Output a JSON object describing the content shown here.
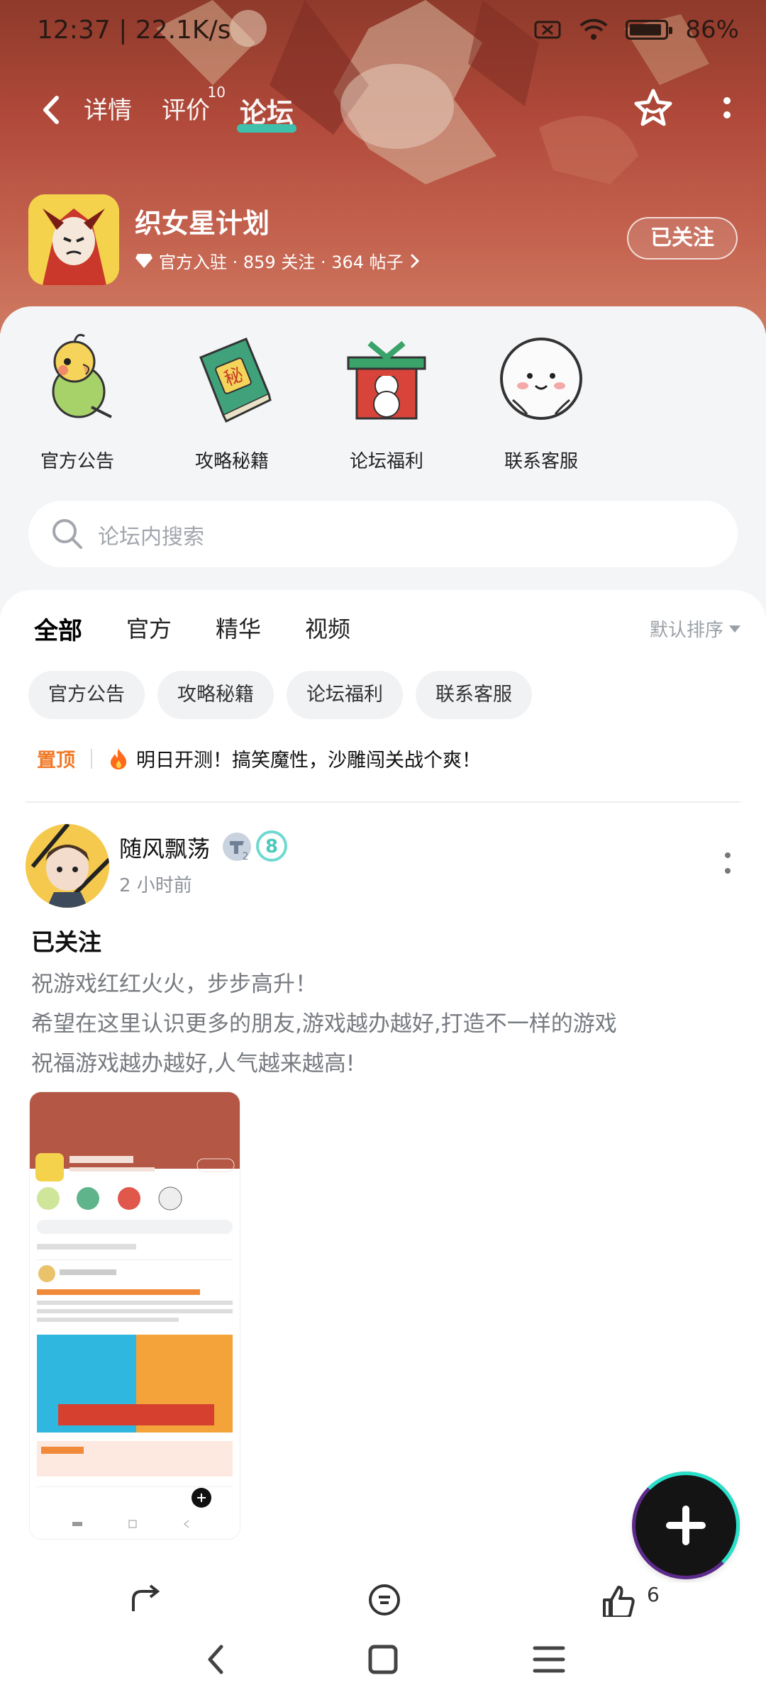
{
  "status_bar": {
    "time_speed": "12:37 | 22.1K/s",
    "battery": "86%"
  },
  "nav": {
    "tabs": [
      {
        "label": "详情",
        "badge": ""
      },
      {
        "label": "评价",
        "badge": "10"
      },
      {
        "label": "论坛",
        "badge": ""
      }
    ],
    "active_tab": "论坛"
  },
  "app": {
    "name": "织女星计划",
    "meta": "官方入驻 · 859 关注 · 364 帖子",
    "follow_label": "已关注"
  },
  "quick_entries": [
    {
      "label": "官方公告",
      "icon": "parrot-icon"
    },
    {
      "label": "攻略秘籍",
      "icon": "secret-book-icon"
    },
    {
      "label": "论坛福利",
      "icon": "gift-box-icon"
    },
    {
      "label": "联系客服",
      "icon": "support-face-icon"
    }
  ],
  "search": {
    "placeholder": "论坛内搜索"
  },
  "feed": {
    "tabs": [
      "全部",
      "官方",
      "精华",
      "视频"
    ],
    "active_tab": "全部",
    "sort_label": "默认排序",
    "chips": [
      "官方公告",
      "攻略秘籍",
      "论坛福利",
      "联系客服"
    ],
    "pinned": {
      "tag": "置顶",
      "text": "明日开测！搞笑魔性，沙雕闯关战个爽！"
    }
  },
  "post": {
    "author": "随风飘荡",
    "badge_level": "2",
    "badge_num": "8",
    "time": "2 小时前",
    "title": "已关注",
    "lines": [
      "祝游戏红红火火，步步高升！",
      "希望在这里认识更多的朋友,游戏越办越好,打造不一样的游戏",
      "祝福游戏越办越好,人气越来越高!"
    ],
    "like_count": "6"
  },
  "colors": {
    "accent": "#2bd4c0",
    "pinned": "#f07a28",
    "banner": "#b0493a"
  }
}
